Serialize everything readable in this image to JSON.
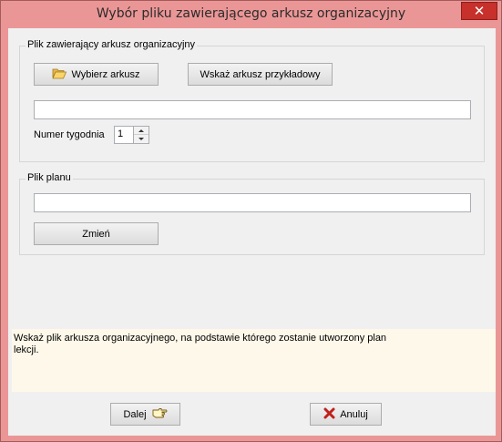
{
  "window": {
    "title": "Wybór pliku zawierającego arkusz organizacyjny",
    "close_label": "✕"
  },
  "org_sheet_group": {
    "legend": "Plik zawierający arkusz organizacyjny",
    "choose_button": "Wybierz arkusz",
    "choose_icon": "folder-open-icon",
    "example_button": "Wskaż arkusz przykładowy",
    "path_value": "",
    "week_label": "Numer tygodnia",
    "week_value": "1"
  },
  "plan_group": {
    "legend": "Plik planu",
    "path_value": "",
    "change_button": "Zmień"
  },
  "hint": {
    "text": "Wskaż plik arkusza organizacyjnego,  na podstawie którego zostanie utworzony plan lekcji."
  },
  "footer": {
    "next_button": "Dalej",
    "next_icon": "pointing-hand-icon",
    "cancel_button": "Anuluj",
    "cancel_icon": "red-x-icon"
  },
  "colors": {
    "titlebar": "#eb9696",
    "close": "#c7302b",
    "client": "#f0f0f0",
    "hint_bg": "#fdf8ea"
  }
}
